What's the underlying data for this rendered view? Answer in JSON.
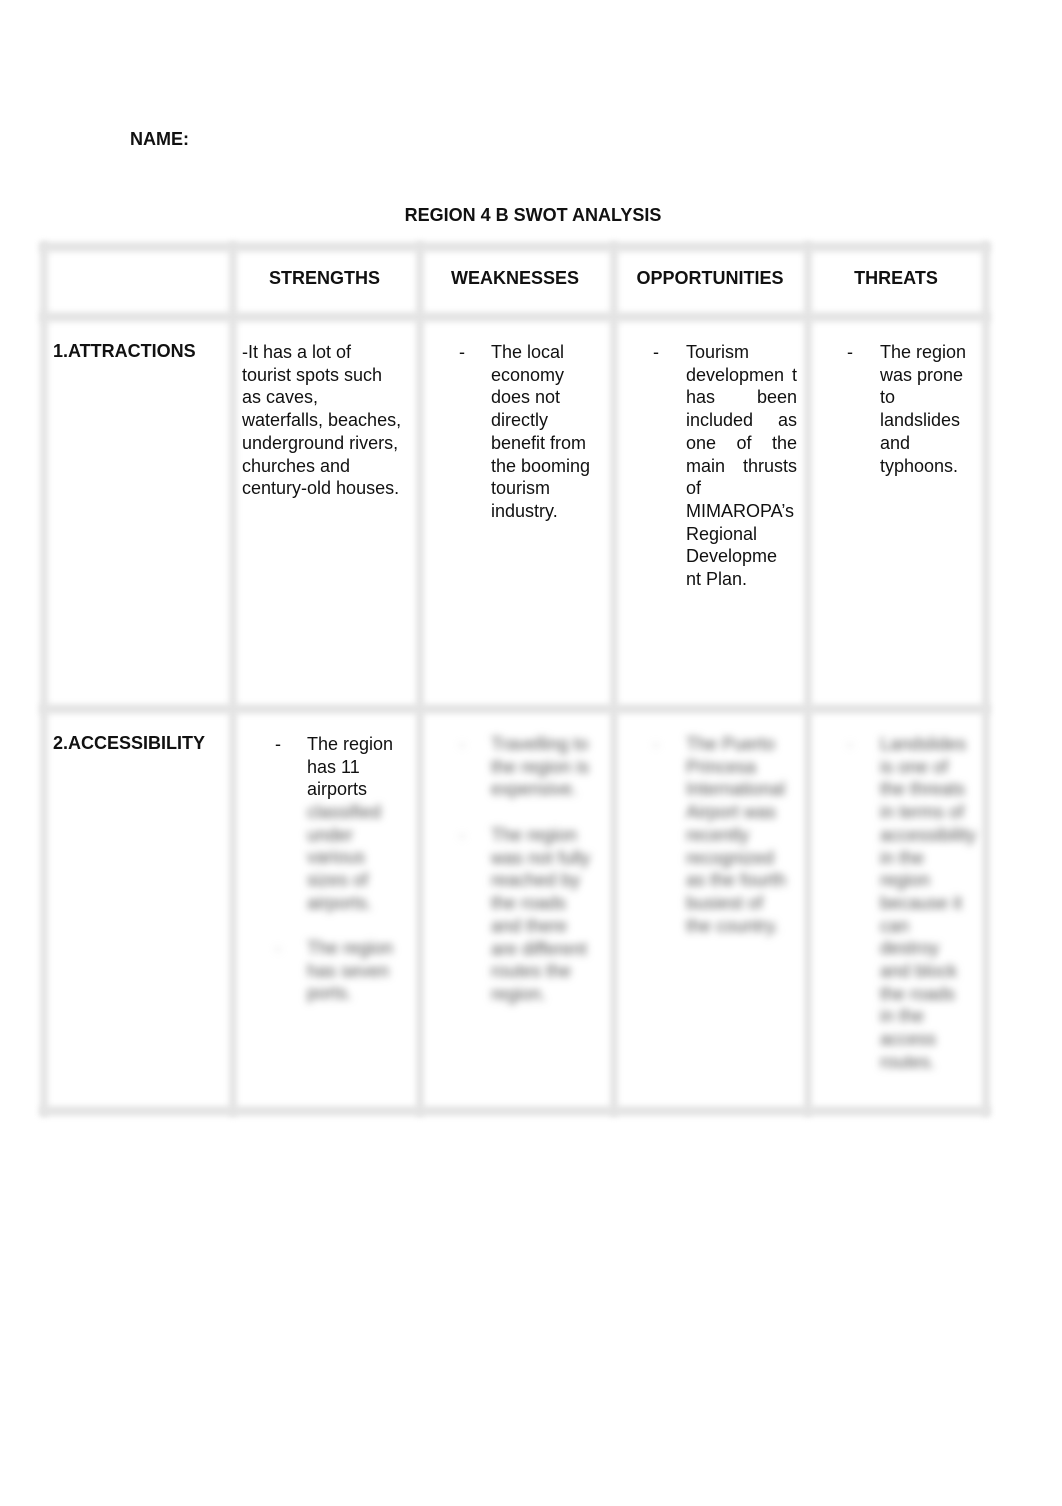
{
  "document": {
    "name_label": "NAME:",
    "title": "REGION 4 B SWOT ANALYSIS"
  },
  "table": {
    "headers": [
      "",
      "STRENGTHS",
      "WEAKNESSES",
      "OPPORTUNITIES",
      "THREATS"
    ],
    "rows": [
      {
        "label": "1.ATTRACTIONS",
        "strengths": "-It has a lot of tourist spots such as caves, waterfalls, beaches, underground rivers, churches and century-old houses.",
        "weaknesses": {
          "bullet": "-",
          "text": "The local economy does not directly benefit from the booming tourism industry."
        },
        "opportunities": {
          "bullet": "-",
          "text": "Tourism developmen t has been included as one of the main thrusts of MIMAROPA’s Regional Developme nt Plan."
        },
        "threats": {
          "bullet": "-",
          "text": "The region was prone to landslides and typhoons."
        }
      },
      {
        "label": "2.ACCESSIBILITY",
        "strengths": {
          "bullet": "-",
          "text": "The region has 11 airports",
          "blurred_1": "classified under various sizes of airports.",
          "blurred_2": "The region has seven ports."
        },
        "weaknesses": {
          "blurred_1": "Travelling to the region is expensive.",
          "blurred_2": "The region was not fully reached by the roads and there are different routes the region."
        },
        "opportunities": {
          "blurred_1": "The Puerto Princesa International Airport was recently recognized as the fourth busiest of the country."
        },
        "threats": {
          "blurred_1": "Landslides is one of the threats in terms of accessibility in the region because it can destroy and block the roads in the access routes."
        }
      }
    ]
  }
}
